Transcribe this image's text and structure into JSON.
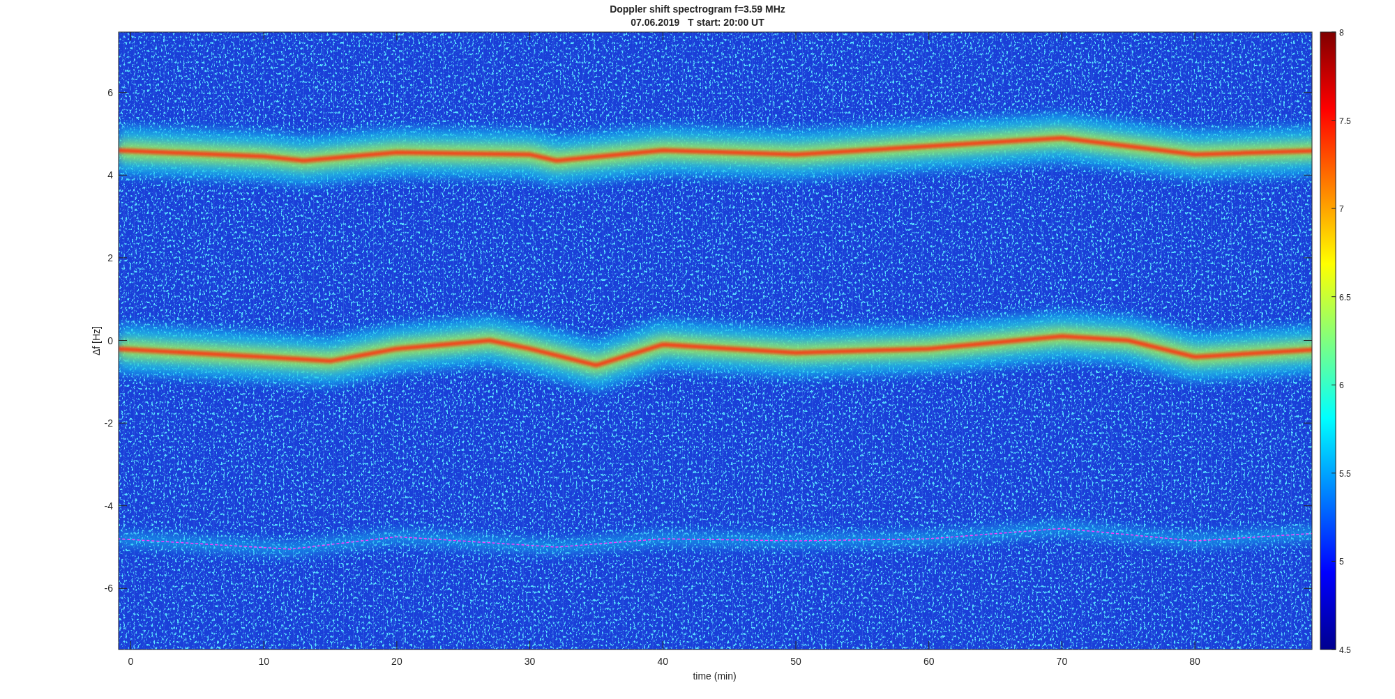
{
  "figure": {
    "title": "Doppler shift spectrogram f=3.59 MHz",
    "subtitle": "07.06.2019   T start: 20:00 UT"
  },
  "axes": {
    "xlabel": "time (min)",
    "ylabel": "Δf [Hz]",
    "xticks": [
      "0",
      "10",
      "20",
      "30",
      "40",
      "50",
      "60",
      "70",
      "80"
    ],
    "yticks": [
      "6",
      "4",
      "2",
      "0",
      "-2",
      "-4",
      "-6"
    ]
  },
  "colorbar": {
    "ticks": [
      "8",
      "7.5",
      "7",
      "6.5",
      "6",
      "5.5",
      "5",
      "4.5"
    ]
  }
}
